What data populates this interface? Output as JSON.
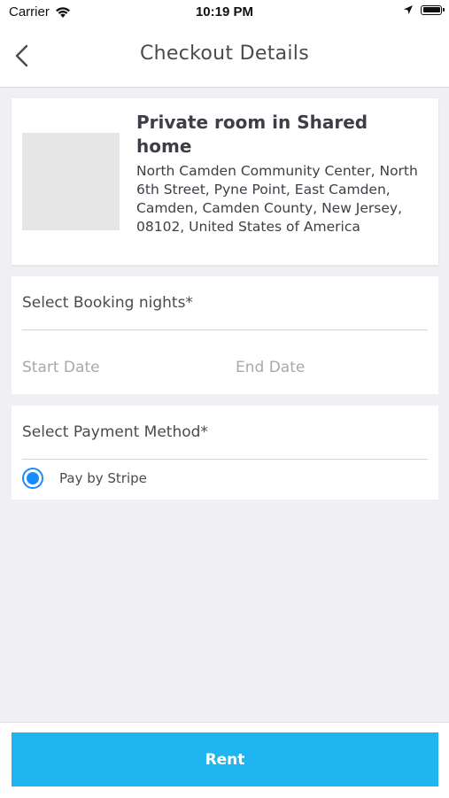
{
  "status_bar": {
    "carrier": "Carrier",
    "time": "10:19 PM"
  },
  "nav": {
    "title": "Checkout Details"
  },
  "listing": {
    "title": "Private room in Shared home",
    "address": "North Camden Community Center, North 6th Street, Pyne Point, East Camden, Camden, Camden County, New Jersey, 08102, United States of America"
  },
  "booking": {
    "label": "Select Booking nights*",
    "start_placeholder": "Start Date",
    "end_placeholder": "End Date"
  },
  "payment": {
    "label": "Select Payment Method*",
    "options": [
      {
        "label": "Pay by Stripe",
        "selected": true
      }
    ]
  },
  "footer": {
    "rent_label": "Rent"
  },
  "colors": {
    "accent": "#1fb5f1",
    "radio": "#1a8cff",
    "background": "#f0f0f4"
  }
}
